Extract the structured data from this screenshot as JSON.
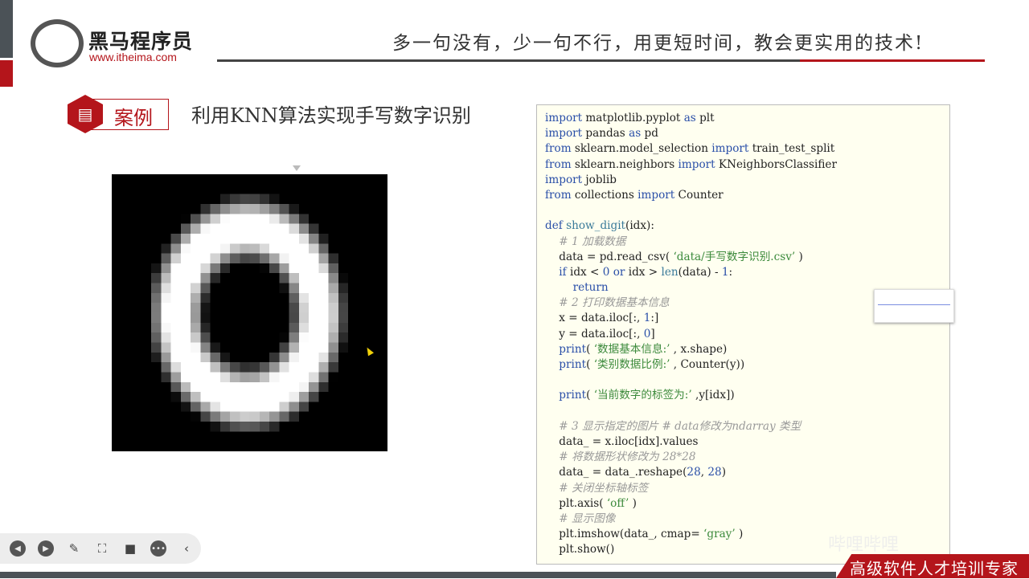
{
  "header": {
    "logo_name": "黑马程序员",
    "logo_url": "www.itheima.com",
    "slogan": "多一句没有，少一句不行，用更短时间，教会更实用的技术!"
  },
  "section": {
    "badge": "案例",
    "title": "利用KNN算法实现手写数字识别"
  },
  "code": [
    [
      [
        "kw",
        "import"
      ],
      [
        "t",
        " matplotlib.pyplot "
      ],
      [
        "kw",
        "as"
      ],
      [
        "t",
        " plt"
      ]
    ],
    [
      [
        "kw",
        "import"
      ],
      [
        "t",
        " pandas "
      ],
      [
        "kw",
        "as"
      ],
      [
        "t",
        " pd"
      ]
    ],
    [
      [
        "kw",
        "from"
      ],
      [
        "t",
        " sklearn.model_selection "
      ],
      [
        "kw",
        "import"
      ],
      [
        "t",
        " train_test_split"
      ]
    ],
    [
      [
        "kw",
        "from"
      ],
      [
        "t",
        " sklearn.neighbors "
      ],
      [
        "kw",
        "import"
      ],
      [
        "t",
        " KNeighborsClassifier"
      ]
    ],
    [
      [
        "kw",
        "import"
      ],
      [
        "t",
        " joblib"
      ]
    ],
    [
      [
        "kw",
        "from"
      ],
      [
        "t",
        " collections "
      ],
      [
        "kw",
        "import"
      ],
      [
        "t",
        " Counter"
      ]
    ],
    [],
    [
      [
        "kw",
        "def"
      ],
      [
        "t",
        " "
      ],
      [
        "fn",
        "show_digit"
      ],
      [
        "t",
        "(idx):"
      ]
    ],
    [
      [
        "t",
        "    "
      ],
      [
        "cm",
        "# 1 加载数据"
      ]
    ],
    [
      [
        "t",
        "    data = pd.read_csv( "
      ],
      [
        "str",
        "‘data/手写数字识别.csv’"
      ],
      [
        "t",
        " )"
      ]
    ],
    [
      [
        "t",
        "    "
      ],
      [
        "kw",
        "if"
      ],
      [
        "t",
        " idx < "
      ],
      [
        "num",
        "0"
      ],
      [
        "t",
        " "
      ],
      [
        "kw",
        "or"
      ],
      [
        "t",
        " idx > "
      ],
      [
        "fn",
        "len"
      ],
      [
        "t",
        "(data) - "
      ],
      [
        "num",
        "1"
      ],
      [
        "t",
        ":"
      ]
    ],
    [
      [
        "t",
        "        "
      ],
      [
        "kw",
        "return"
      ]
    ],
    [
      [
        "t",
        "    "
      ],
      [
        "cm",
        "# 2 打印数据基本信息"
      ]
    ],
    [
      [
        "t",
        "    x = data.iloc[:, "
      ],
      [
        "num",
        "1"
      ],
      [
        "t",
        ":]"
      ]
    ],
    [
      [
        "t",
        "    y = data.iloc[:, "
      ],
      [
        "num",
        "0"
      ],
      [
        "t",
        "]"
      ]
    ],
    [
      [
        "t",
        "    "
      ],
      [
        "kw",
        "print"
      ],
      [
        "t",
        "( "
      ],
      [
        "str",
        "‘数据基本信息:’"
      ],
      [
        "t",
        " , x.shape)"
      ]
    ],
    [
      [
        "t",
        "    "
      ],
      [
        "kw",
        "print"
      ],
      [
        "t",
        "( "
      ],
      [
        "str",
        "‘类别数据比例:’"
      ],
      [
        "t",
        " , Counter(y))"
      ]
    ],
    [],
    [
      [
        "t",
        "    "
      ],
      [
        "kw",
        "print"
      ],
      [
        "t",
        "( "
      ],
      [
        "str",
        "‘当前数字的标签为:’"
      ],
      [
        "t",
        " ,y[idx])"
      ]
    ],
    [],
    [
      [
        "t",
        "    "
      ],
      [
        "cm",
        "# 3 显示指定的图片 # data修改为ndarray 类型"
      ]
    ],
    [
      [
        "t",
        "    data_ = x.iloc[idx].values"
      ]
    ],
    [
      [
        "t",
        "    "
      ],
      [
        "cm",
        "# 将数据形状修改为 28*28"
      ]
    ],
    [
      [
        "t",
        "    data_ = data_.reshape("
      ],
      [
        "num",
        "28"
      ],
      [
        "t",
        ", "
      ],
      [
        "num",
        "28"
      ],
      [
        "t",
        ")"
      ]
    ],
    [
      [
        "t",
        "    "
      ],
      [
        "cm",
        "# 关闭坐标轴标签"
      ]
    ],
    [
      [
        "t",
        "    plt.axis( "
      ],
      [
        "str",
        "‘off’"
      ],
      [
        "t",
        " )"
      ]
    ],
    [
      [
        "t",
        "    "
      ],
      [
        "cm",
        "# 显示图像"
      ]
    ],
    [
      [
        "t",
        "    plt.imshow(data_, cmap= "
      ],
      [
        "str",
        "‘gray’"
      ],
      [
        "t",
        " )"
      ]
    ],
    [
      [
        "t",
        "    plt.show()"
      ]
    ]
  ],
  "footer": {
    "tagline": "高级软件人才培训专家",
    "watermark": "哔哩哔哩"
  },
  "toolbar": {
    "items": [
      "previous-icon",
      "next-icon",
      "pen-icon",
      "screenshot-icon",
      "camera-icon",
      "more-icon",
      "collapse-icon"
    ]
  },
  "colors": {
    "brand_red": "#b4151b",
    "code_bg": "#fffff0"
  }
}
